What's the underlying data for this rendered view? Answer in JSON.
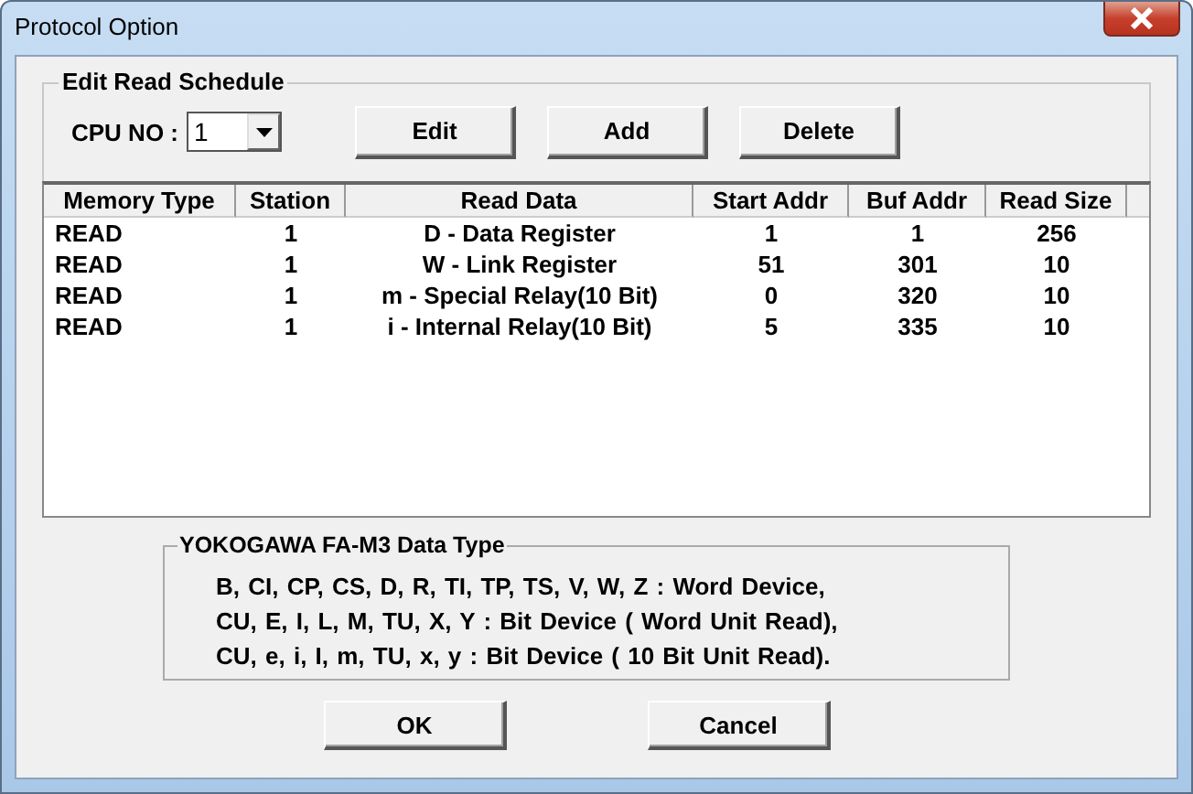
{
  "window": {
    "title": "Protocol Option"
  },
  "schedule": {
    "title": "Edit Read Schedule",
    "cpu_label": "CPU NO :",
    "cpu_value": "1",
    "buttons": [
      "Edit",
      "Add",
      "Delete"
    ]
  },
  "table": {
    "columns": [
      "Memory Type",
      "Station",
      "Read Data",
      "Start Addr",
      "Buf Addr",
      "Read Size"
    ],
    "rows": [
      [
        "READ",
        "1",
        "D - Data Register",
        "1",
        "1",
        "256"
      ],
      [
        "READ",
        "1",
        "W - Link Register",
        "51",
        "301",
        "10"
      ],
      [
        "READ",
        "1",
        "m - Special Relay(10 Bit)",
        "0",
        "320",
        "10"
      ],
      [
        "READ",
        "1",
        "i - Internal Relay(10 Bit)",
        "5",
        "335",
        "10"
      ]
    ]
  },
  "data_type": {
    "title": "YOKOGAWA FA-M3 Data Type",
    "lines": [
      "B, CI, CP, CS, D, R, TI, TP, TS, V, W, Z : Word Device,",
      "CU, E, I, L, M, TU, X, Y : Bit Device ( Word Unit Read),",
      "CU, e, i, I, m, TU, x, y : Bit Device ( 10 Bit Unit Read)."
    ]
  },
  "buttons": [
    "OK",
    "Cancel"
  ]
}
